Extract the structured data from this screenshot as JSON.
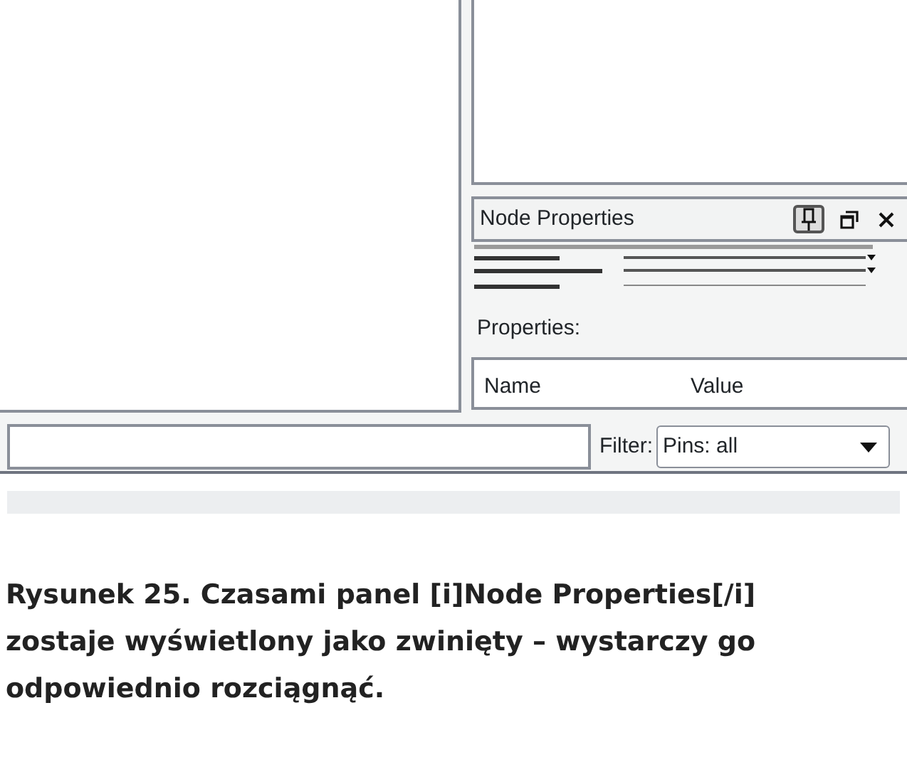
{
  "panel": {
    "title": "Node Properties",
    "pin_pressed": true
  },
  "properties_label": "Properties:",
  "table": {
    "columns": [
      "Name",
      "Value"
    ]
  },
  "filter": {
    "label": "Filter:",
    "value": "Pins: all"
  },
  "caption": "Rysunek 25. Czasami panel [i]Node Properties[/i] zostaje wyświetlony jako zwinięty – wystarczy go odpowiednio rozciągnąć."
}
